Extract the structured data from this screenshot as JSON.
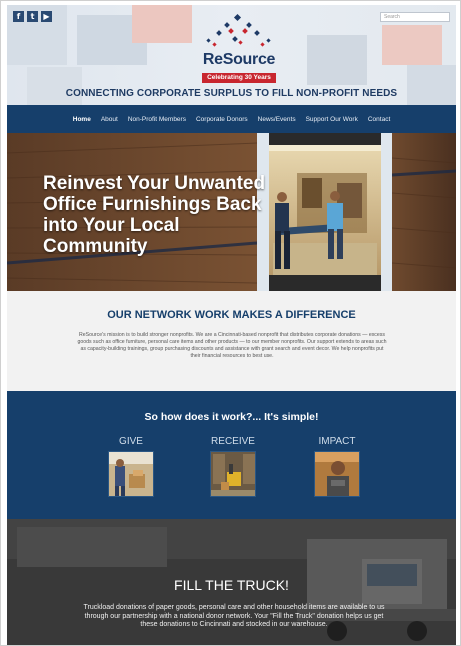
{
  "header": {
    "social_icons": [
      "facebook-icon",
      "twitter-icon",
      "youtube-icon"
    ],
    "social_glyphs": [
      "f",
      "t",
      "▶"
    ],
    "search_placeholder": "Search",
    "logo_name": "ReSource",
    "logo_ribbon": "Celebrating 30 Years",
    "tagline": "CONNECTING CORPORATE SURPLUS TO FILL NON-PROFIT NEEDS"
  },
  "nav": {
    "items": [
      "Home",
      "About",
      "Non-Profit Members",
      "Corporate Donors",
      "News/Events",
      "Support Our Work",
      "Contact"
    ],
    "active_index": 0
  },
  "hero": {
    "headline": "Reinvest Your Unwanted Office Furnishings Back into Your Local Community"
  },
  "mission": {
    "title": "OUR NETWORK WORK MAKES A DIFFERENCE",
    "body": "ReSource's mission is to build stronger nonprofits. We are a Cincinnati-based nonprofit that distributes corporate donations — excess goods such as office furniture, personal care items and other products — to our member nonprofits. Our support extends to areas such as capacity-building trainings, group purchasing discounts and assistance with grant search and event decor. We help nonprofits put their financial resources to best use."
  },
  "how": {
    "title": "So how does it work?... It's simple!",
    "steps": [
      {
        "label": "GIVE"
      },
      {
        "label": "RECEIVE"
      },
      {
        "label": "IMPACT"
      }
    ]
  },
  "truck": {
    "title": "FILL THE TRUCK!",
    "body": "Truckload donations of paper goods, personal care and other household items are available to us through our partnership with a national donor network. Your \"Fill the Truck\" donation helps us get these donations to Cincinnati and stocked in our warehouse."
  },
  "colors": {
    "navy": "#163f6b",
    "brand_red": "#c8262f",
    "header_bg": "#e3e9ef"
  }
}
